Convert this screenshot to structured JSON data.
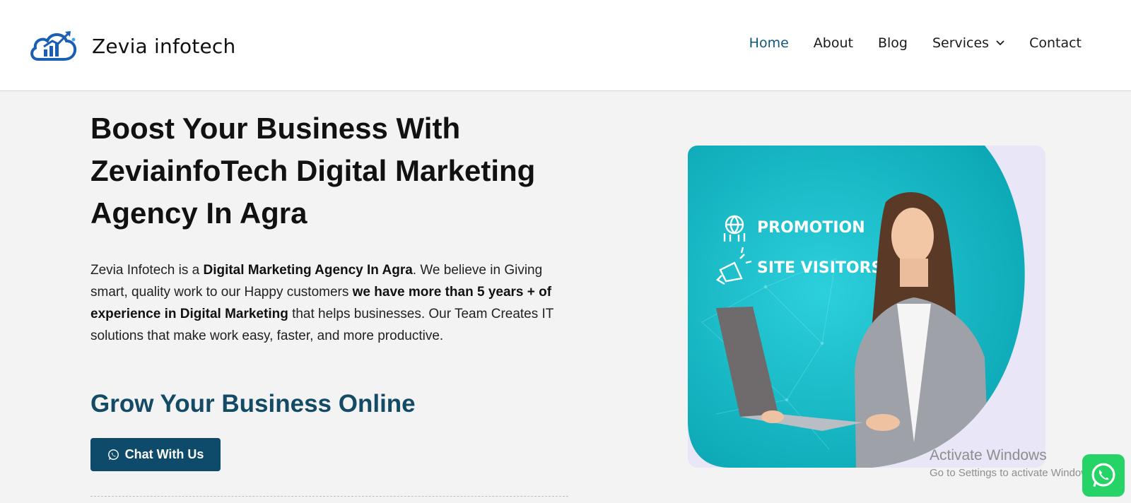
{
  "brand": {
    "name": "Zevia infotech"
  },
  "nav": {
    "items": [
      {
        "label": "Home",
        "active": true
      },
      {
        "label": "About"
      },
      {
        "label": "Blog"
      },
      {
        "label": "Services",
        "has_dropdown": true
      },
      {
        "label": "Contact"
      }
    ]
  },
  "hero": {
    "title": "Boost Your Business With ZeviainfoTech Digital Marketing Agency In Agra",
    "para": {
      "t1": "Zevia Infotech is a ",
      "b1": "Digital Marketing Agency In Agra",
      "t2": ". We believe in Giving smart, quality work to our Happy customers ",
      "b2": "we have more than 5 years + of experience in Digital Marketing",
      "t3": " that helps businesses. Our Team Creates IT solutions that make work easy, faster, and more productive."
    },
    "subtitle": "Grow Your Business Online",
    "cta_label": "Chat With Us"
  },
  "banner": {
    "promotion": "PROMOTION",
    "site_visitors": "SITE VISITORS"
  },
  "windows_watermark": {
    "line1": "Activate Windows",
    "line2": "Go to Settings to activate Windows."
  },
  "colors": {
    "accent": "#10587a",
    "button": "#0e4a69",
    "teal": "#15b7c4",
    "whatsapp": "#25d366"
  },
  "icons": [
    "logo-cloud-icon",
    "chevron-down-icon",
    "whatsapp-icon",
    "globe-people-icon",
    "megaphone-icon"
  ]
}
